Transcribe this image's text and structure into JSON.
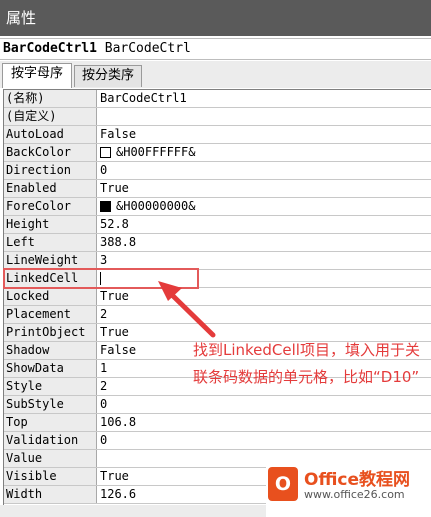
{
  "window": {
    "title": "属性"
  },
  "object_selector": {
    "name": "BarCodeCtrl1",
    "type": "BarCodeCtrl"
  },
  "tabs": [
    {
      "label": "按字母序",
      "active": true
    },
    {
      "label": "按分类序",
      "active": false
    }
  ],
  "properties": [
    {
      "name": "(名称)",
      "value": "BarCodeCtrl1"
    },
    {
      "name": "(自定义)",
      "value": ""
    },
    {
      "name": "AutoLoad",
      "value": "False"
    },
    {
      "name": "BackColor",
      "value": "&H00FFFFFF&",
      "swatch": "#ffffff"
    },
    {
      "name": "Direction",
      "value": "0"
    },
    {
      "name": "Enabled",
      "value": "True"
    },
    {
      "name": "ForeColor",
      "value": "&H00000000&",
      "swatch": "#000000"
    },
    {
      "name": "Height",
      "value": "52.8"
    },
    {
      "name": "Left",
      "value": "388.8"
    },
    {
      "name": "LineWeight",
      "value": "3"
    },
    {
      "name": "LinkedCell",
      "value": "",
      "editing": true
    },
    {
      "name": "Locked",
      "value": "True"
    },
    {
      "name": "Placement",
      "value": "2"
    },
    {
      "name": "PrintObject",
      "value": "True"
    },
    {
      "name": "Shadow",
      "value": "False"
    },
    {
      "name": "ShowData",
      "value": "1"
    },
    {
      "name": "Style",
      "value": "2"
    },
    {
      "name": "SubStyle",
      "value": "0"
    },
    {
      "name": "Top",
      "value": "106.8"
    },
    {
      "name": "Validation",
      "value": "0"
    },
    {
      "name": "Value",
      "value": ""
    },
    {
      "name": "Visible",
      "value": "True"
    },
    {
      "name": "Width",
      "value": "126.6"
    }
  ],
  "annotation": {
    "text": "找到LinkedCell项目，填入用于关联条码数据的单元格，比如“D10”",
    "color": "#e43b3b"
  },
  "watermark": {
    "badge": "O",
    "brand": "Office教程网",
    "url": "www.office26.com",
    "color": "#e8501e"
  }
}
